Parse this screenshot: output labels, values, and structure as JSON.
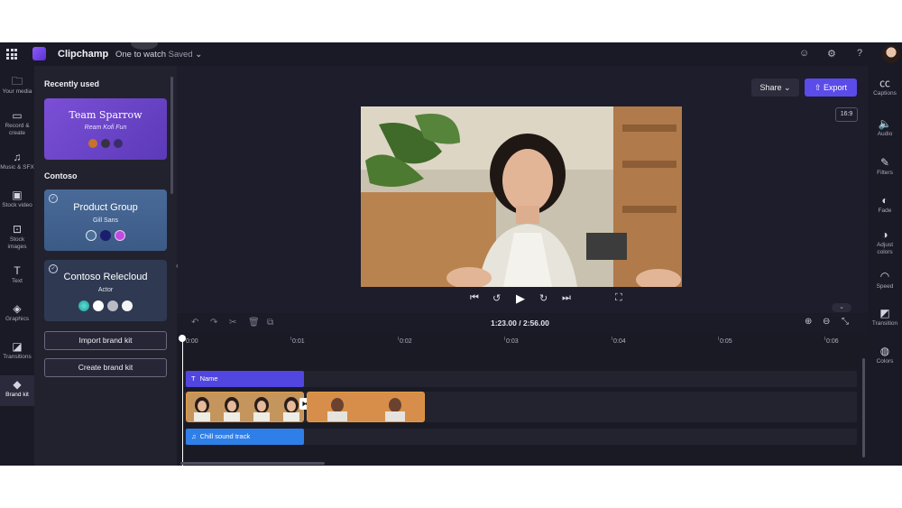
{
  "topbar": {
    "app_name": "Clipchamp",
    "project_name": "One to watch",
    "save_status": "Saved",
    "icons": [
      "apps-grid-icon",
      "clipchamp-logo",
      "feedback-icon",
      "settings-icon",
      "help-icon",
      "profile-avatar"
    ]
  },
  "left_rail": {
    "items": [
      {
        "label": "Your media",
        "icon": "folder-icon"
      },
      {
        "label": "Record & create",
        "icon": "camera-icon"
      },
      {
        "label": "Music & SFX",
        "icon": "music-icon"
      },
      {
        "label": "Stock video",
        "icon": "film-icon"
      },
      {
        "label": "Stock images",
        "icon": "image-icon"
      },
      {
        "label": "Text",
        "icon": "text-icon"
      },
      {
        "label": "Graphics",
        "icon": "shapes-icon"
      },
      {
        "label": "Transitions",
        "icon": "transitions-icon"
      },
      {
        "label": "Brand kit",
        "icon": "brand-kit-icon"
      }
    ],
    "active": "Brand kit"
  },
  "panel": {
    "recently_used_heading": "Recently used",
    "contoso_heading": "Contoso",
    "kits": [
      {
        "title": "Team Sparrow",
        "subtitle": "Ream Kofi Fun",
        "swatches": [
          "#c8732a",
          "#3a3140",
          "#3b2d6b"
        ]
      },
      {
        "title": "Product Group",
        "subtitle": "Gill Sans",
        "swatches": [
          "#4c6f9a",
          "#1b1d6e",
          "#c04be0"
        ]
      },
      {
        "title": "Contoso Relecloud",
        "subtitle": "Actor",
        "swatches": [
          "#2fb8b0",
          "#ffffff",
          "#b9bcc6",
          "#f4f4f6"
        ]
      }
    ],
    "import_button": "Import brand kit",
    "create_button": "Create brand kit"
  },
  "preview": {
    "share_label": "Share",
    "export_label": "Export",
    "aspect_ratio": "16:9"
  },
  "right_rail": {
    "items": [
      {
        "label": "Captions",
        "icon": "captions-icon"
      },
      {
        "label": "Audio",
        "icon": "audio-icon"
      },
      {
        "label": "Filters",
        "icon": "filters-icon"
      },
      {
        "label": "Fade",
        "icon": "fade-icon"
      },
      {
        "label": "Adjust colors",
        "icon": "adjust-colors-icon"
      },
      {
        "label": "Speed",
        "icon": "speed-icon"
      },
      {
        "label": "Transition",
        "icon": "transition-icon"
      },
      {
        "label": "Colors",
        "icon": "colors-icon"
      }
    ]
  },
  "timeline": {
    "current_time": "1:23.00",
    "separator": "/",
    "total_time": "2:56.00",
    "ticks": [
      "0:00",
      "0:01",
      "0:02",
      "0:03",
      "0:04",
      "0:05",
      "0:06"
    ],
    "text_clip": "Name",
    "audio_clip": "Chill sound track"
  },
  "colors": {
    "accent": "#5b4be8",
    "text_clip": "#5146e0",
    "audio_clip": "#2f7fe8",
    "video_clip_border": "#e59a3d"
  }
}
